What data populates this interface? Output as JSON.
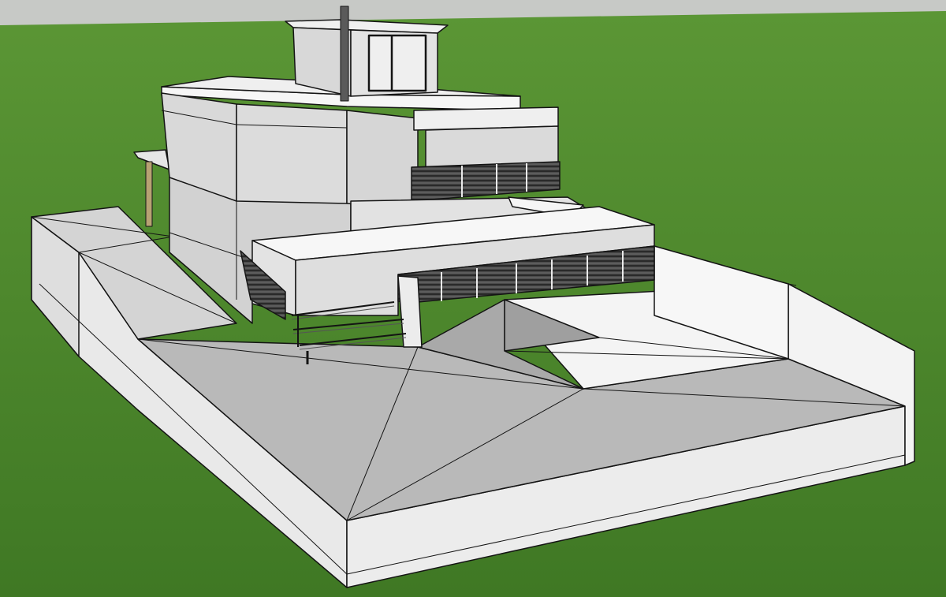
{
  "scene": {
    "subject": "3d-model-house-on-sloped-lot",
    "sky_color": "#c7c9c6",
    "ground_color": "#4f8a2b",
    "model_face_light": "#f1f1f1",
    "model_face_mid": "#dcdcdc",
    "model_face_dark": "#bdbdbd",
    "outline_color": "#141414",
    "railing_color": "#3a3a3a",
    "post_color": "#b7a273"
  }
}
